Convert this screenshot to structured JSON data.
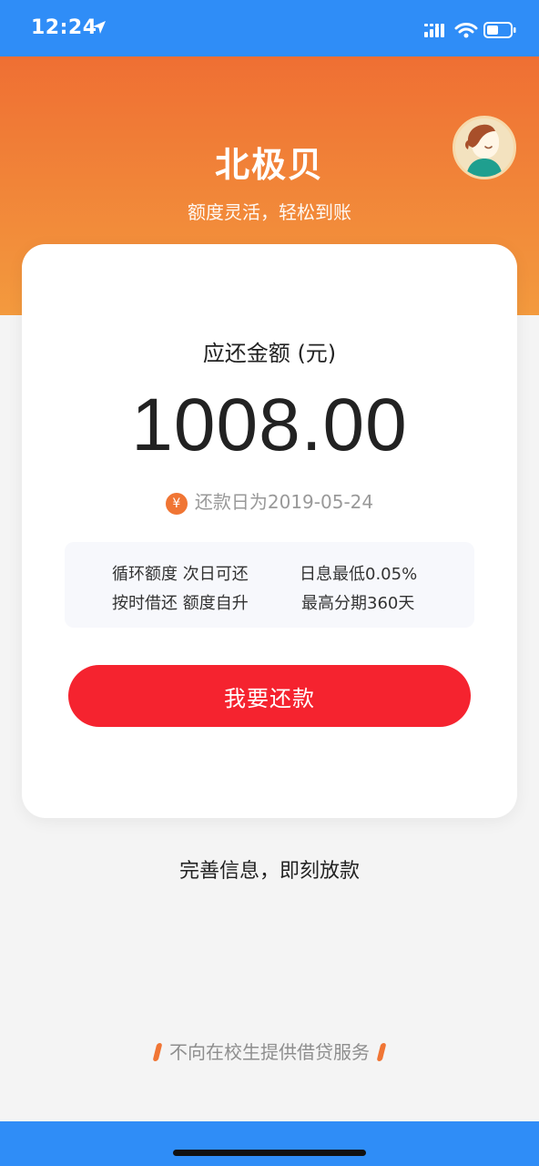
{
  "status_bar": {
    "time": "12:24",
    "icons": [
      "location-arrow-icon",
      "cellular-signal-icon",
      "wifi-icon",
      "battery-icon"
    ],
    "background": "#2f8df7"
  },
  "header": {
    "title": "北极贝",
    "subtitle": "额度灵活，轻松到账",
    "gradient_top": "#ef6f33",
    "gradient_bottom": "#f39a3e",
    "avatar_icon": "user-avatar-icon"
  },
  "card": {
    "amount_label": "应还金额 (元)",
    "amount": "1008.00",
    "due_icon_text": "¥",
    "due_text": "还款日为2019-05-24",
    "features": [
      "循环额度 次日可还",
      "日息最低0.05%",
      "按时借还 额度自升",
      "最高分期360天"
    ],
    "button_label": "我要还款",
    "button_color": "#f5232f"
  },
  "footer": {
    "complete_info": "完善信息，即刻放款",
    "notice": "不向在校生提供借贷服务",
    "accent": "#f07534"
  }
}
